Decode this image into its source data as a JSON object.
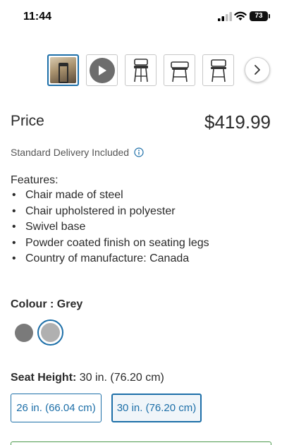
{
  "status_bar": {
    "time": "11:44",
    "battery": "73"
  },
  "gallery": {
    "thumbnails": [
      {
        "kind": "photo",
        "icon": "stool-photo-icon"
      },
      {
        "kind": "video",
        "icon": "play-icon"
      },
      {
        "kind": "drawing",
        "icon": "stool-drawing-icon"
      },
      {
        "kind": "drawing",
        "icon": "stool-drawing-icon"
      },
      {
        "kind": "drawing",
        "icon": "stool-drawing-icon"
      }
    ],
    "next_icon": "chevron-right-icon"
  },
  "price": {
    "label": "Price",
    "value": "$419.99"
  },
  "delivery": {
    "text": "Standard Delivery Included",
    "icon": "info-icon"
  },
  "features": {
    "title": "Features:",
    "items": [
      "Chair made of steel",
      "Chair upholstered in polyester",
      "Swivel base",
      "Powder coated finish on seating legs",
      "Country of manufacture: Canada"
    ]
  },
  "colour": {
    "label": "Colour : Grey",
    "swatches": [
      {
        "color": "#7a7a7a",
        "selected": false
      },
      {
        "color": "#b0b0b0",
        "selected": true
      }
    ]
  },
  "seat_height": {
    "label": "Seat Height:",
    "value": " 30 in. (76.20 cm)",
    "options": [
      {
        "label": "26 in. (66.04 cm)",
        "selected": false
      },
      {
        "label": "30 in. (76.20 cm)",
        "selected": true
      }
    ]
  },
  "colors": {
    "accent": "#1d6fa8",
    "text": "#2b2b2b"
  }
}
